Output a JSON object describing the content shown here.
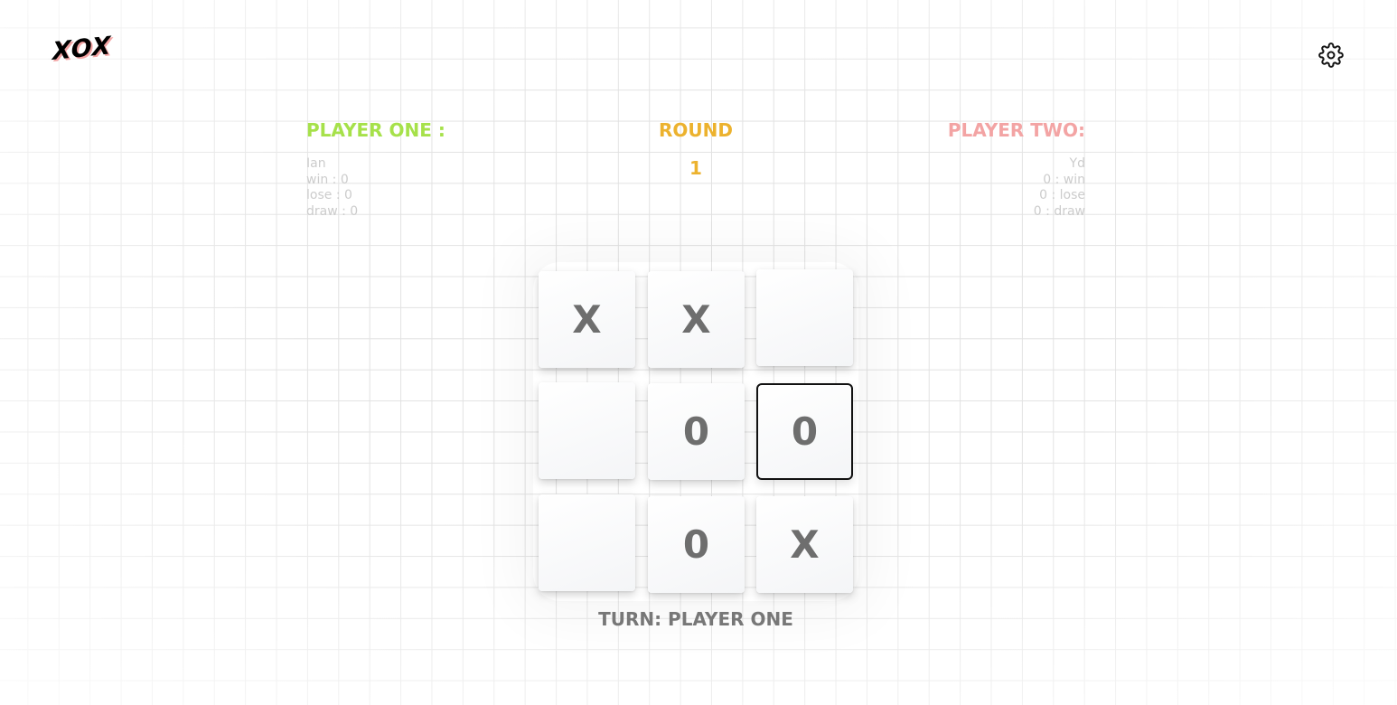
{
  "app": {
    "logo_text": "XOX"
  },
  "icons": {
    "settings": "gear-icon"
  },
  "colors": {
    "player_one": "#a6e14a",
    "round": "#ecb22e",
    "player_two": "#f3a4a4",
    "mark": "#6e6e6e"
  },
  "player_one": {
    "title": "PLAYER ONE :",
    "name": "Ian",
    "win": "win : 0",
    "lose": "lose : 0",
    "draw": "draw : 0"
  },
  "round": {
    "title": "ROUND",
    "number": "1"
  },
  "player_two": {
    "title": "PLAYER TWO:",
    "name": "Yd",
    "win": "0 : win",
    "lose": "0 : lose",
    "draw": "0 : draw"
  },
  "board": {
    "cells": [
      "X",
      "X",
      "",
      "",
      "0",
      "0",
      "",
      "0",
      "X"
    ],
    "selected_cell": 5
  },
  "turn": {
    "label": "TURN: PLAYER ONE"
  }
}
